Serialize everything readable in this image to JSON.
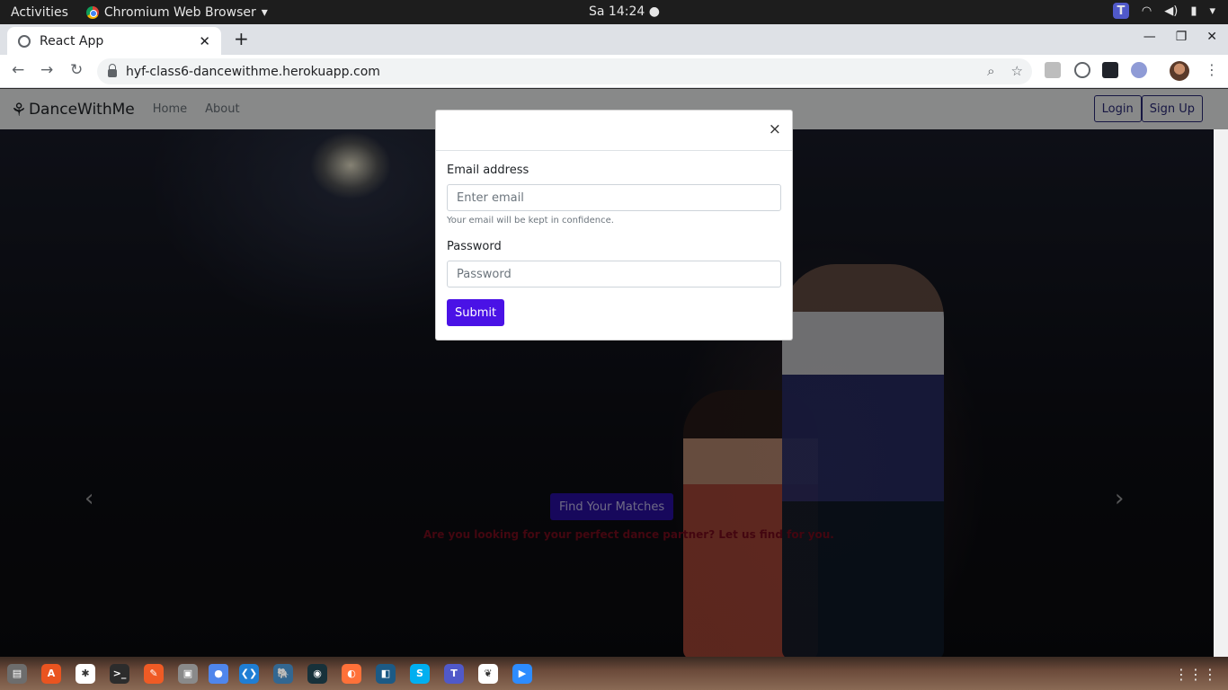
{
  "system": {
    "activities": "Activities",
    "app_name": "Chromium Web Browser",
    "clock": "Sa 14:24 ●",
    "dropdown": "▾"
  },
  "browser": {
    "tab_title": "React App",
    "tab_close": "✕",
    "new_tab": "+",
    "window_controls": {
      "minimize": "—",
      "maximize": "❐",
      "close": "✕"
    },
    "url": "hyf-class6-dancewithme.herokuapp.com",
    "nav": {
      "back": "←",
      "forward": "→",
      "reload": "↻"
    },
    "omni_icons": {
      "zoom": "⌕",
      "bookmark": "☆"
    },
    "menu": "⋮"
  },
  "site": {
    "brand": "DanceWithMe",
    "brand_logo": "⚘",
    "nav_links": [
      "Home",
      "About"
    ],
    "auth": {
      "login": "Login",
      "signup": "Sign Up"
    },
    "hero": {
      "cta": "Find Your Matches",
      "tagline": "Are you looking for your perfect dance partner? Let us find for you.",
      "prev": "‹",
      "next": "›"
    }
  },
  "modal": {
    "close": "×",
    "email_label": "Email address",
    "email_placeholder": "Enter email",
    "email_help": "Your email will be kept in confidence.",
    "password_label": "Password",
    "password_placeholder": "Password",
    "submit": "Submit"
  },
  "taskbar": {
    "icons": [
      {
        "name": "files-icon",
        "glyph": "▤",
        "color": "#6d6d6d"
      },
      {
        "name": "software-icon",
        "glyph": "A",
        "color": "#e95420"
      },
      {
        "name": "slack-icon",
        "glyph": "✱",
        "color": "#ffffff"
      },
      {
        "name": "terminal-icon",
        "glyph": ">_",
        "color": "#2c2c2c"
      },
      {
        "name": "postman-icon",
        "glyph": "✎",
        "color": "#ef5b25"
      },
      {
        "name": "printer-icon",
        "glyph": "▣",
        "color": "#8a8a8a"
      },
      {
        "name": "chromium-icon",
        "glyph": "●",
        "color": "#4f86ec"
      },
      {
        "name": "vscode-icon",
        "glyph": "❮❯",
        "color": "#1f7ed4"
      },
      {
        "name": "postgres-icon",
        "glyph": "🐘",
        "color": "#336791"
      },
      {
        "name": "gitkraken-icon",
        "glyph": "◉",
        "color": "#17313a"
      },
      {
        "name": "firefox-icon",
        "glyph": "◐",
        "color": "#ff7139"
      },
      {
        "name": "mysql-workbench-icon",
        "glyph": "◧",
        "color": "#1c5a85"
      },
      {
        "name": "skype-icon",
        "glyph": "S",
        "color": "#00aff0"
      },
      {
        "name": "teams-icon",
        "glyph": "T",
        "color": "#5059c9"
      },
      {
        "name": "mongodb-icon",
        "glyph": "❦",
        "color": "#ffffff"
      },
      {
        "name": "zoom-icon",
        "glyph": "▶",
        "color": "#2d8cff"
      }
    ],
    "apps_grid": "⋮⋮⋮"
  }
}
